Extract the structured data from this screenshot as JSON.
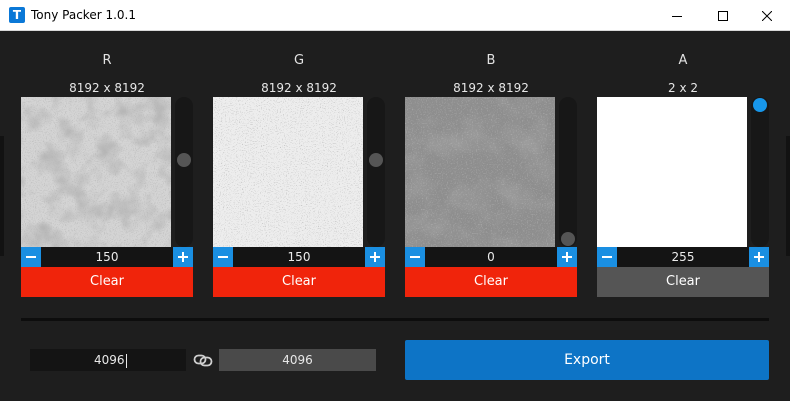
{
  "window": {
    "title": "Tony Packer 1.0.1",
    "icon_letter": "T"
  },
  "channels": [
    {
      "name": "R",
      "size": "8192 x 8192",
      "value": "150",
      "slider_level": 150,
      "clear_label": "Clear",
      "clear_color": "#f0240b",
      "texture": "noisy-dark-speckle"
    },
    {
      "name": "G",
      "size": "8192 x 8192",
      "value": "150",
      "slider_level": 150,
      "clear_label": "Clear",
      "clear_color": "#f0240b",
      "texture": "light-speckle"
    },
    {
      "name": "B",
      "size": "8192 x 8192",
      "value": "0",
      "slider_level": 0,
      "clear_label": "Clear",
      "clear_color": "#f0240b",
      "texture": "gray-mottled"
    },
    {
      "name": "A",
      "size": "2 x 2",
      "value": "255",
      "slider_level": 255,
      "clear_label": "Clear",
      "clear_color": "#555555",
      "texture": "solid-white"
    }
  ],
  "output": {
    "width": "4096",
    "height": "4096",
    "export_label": "Export",
    "link_icon": "chain-link-icon"
  },
  "colors": {
    "accent": "#1a8fe2",
    "export": "#0d74c6",
    "clear_active": "#f0240b",
    "clear_inactive": "#555555",
    "active_thumb": "#1796ea"
  }
}
